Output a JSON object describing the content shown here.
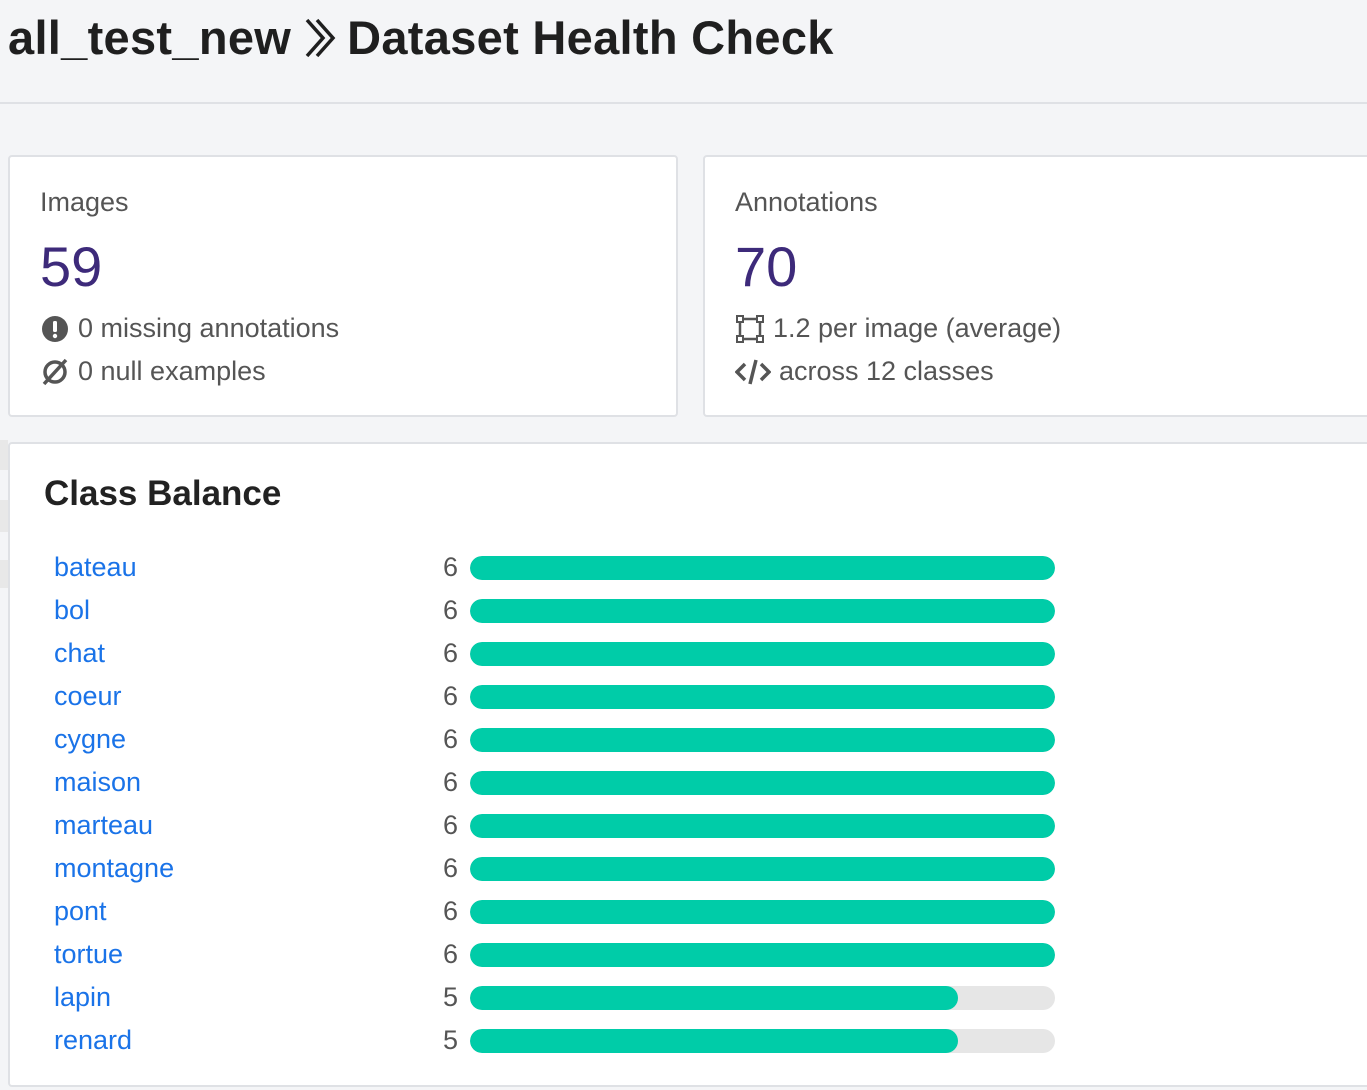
{
  "header": {
    "project": "all_test_new",
    "page_title": "Dataset Health Check"
  },
  "images_card": {
    "label": "Images",
    "value": "59",
    "lines": [
      {
        "icon": "exclamation-circle-icon",
        "text": "0 missing annotations"
      },
      {
        "icon": "null-icon",
        "text": "0 null examples"
      }
    ]
  },
  "annotations_card": {
    "label": "Annotations",
    "value": "70",
    "lines": [
      {
        "icon": "bounding-box-icon",
        "text": "1.2 per image (average)"
      },
      {
        "icon": "code-icon",
        "text": "across 12 classes"
      }
    ]
  },
  "class_balance": {
    "title": "Class Balance",
    "max_count": 6,
    "classes": [
      {
        "name": "bateau",
        "count": "6"
      },
      {
        "name": "bol",
        "count": "6"
      },
      {
        "name": "chat",
        "count": "6"
      },
      {
        "name": "coeur",
        "count": "6"
      },
      {
        "name": "cygne",
        "count": "6"
      },
      {
        "name": "maison",
        "count": "6"
      },
      {
        "name": "marteau",
        "count": "6"
      },
      {
        "name": "montagne",
        "count": "6"
      },
      {
        "name": "pont",
        "count": "6"
      },
      {
        "name": "tortue",
        "count": "6"
      },
      {
        "name": "lapin",
        "count": "5"
      },
      {
        "name": "renard",
        "count": "5"
      }
    ]
  },
  "colors": {
    "bar_fill": "#00cca8",
    "bar_track": "#e6e6e6",
    "link": "#1a73e8",
    "stat_value": "#3d2a7a"
  }
}
